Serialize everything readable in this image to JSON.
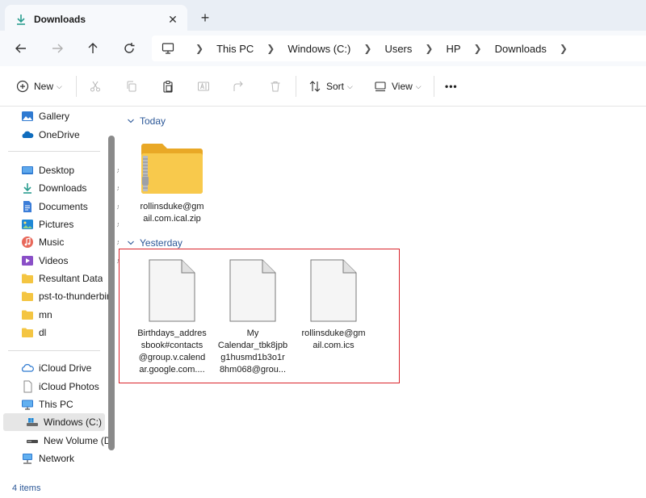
{
  "window": {
    "tab_title": "Downloads",
    "tab_close": "✕",
    "new_tab": "+"
  },
  "breadcrumb": [
    "This PC",
    "Windows (C:)",
    "Users",
    "HP",
    "Downloads"
  ],
  "toolbar": {
    "new_label": "New",
    "sort_label": "Sort",
    "view_label": "View",
    "more_label": "•••"
  },
  "sidebar": {
    "quick": [
      {
        "label": "Gallery",
        "icon": "gallery-icon"
      },
      {
        "label": "OneDrive",
        "icon": "onedrive-icon"
      }
    ],
    "pinned": [
      {
        "label": "Desktop",
        "icon": "desktop-icon",
        "pinned": true
      },
      {
        "label": "Downloads",
        "icon": "downloads-icon",
        "pinned": true
      },
      {
        "label": "Documents",
        "icon": "documents-icon",
        "pinned": true
      },
      {
        "label": "Pictures",
        "icon": "pictures-icon",
        "pinned": true
      },
      {
        "label": "Music",
        "icon": "music-icon",
        "pinned": true
      },
      {
        "label": "Videos",
        "icon": "videos-icon",
        "pinned": true
      },
      {
        "label": "Resultant Data",
        "icon": "folder-icon",
        "pinned": false
      },
      {
        "label": "pst-to-thunderbir",
        "icon": "folder-icon",
        "pinned": false
      },
      {
        "label": "mn",
        "icon": "folder-icon",
        "pinned": false
      },
      {
        "label": "dl",
        "icon": "folder-icon",
        "pinned": false
      }
    ],
    "locations": [
      {
        "label": "iCloud Drive",
        "icon": "icloud-drive-icon"
      },
      {
        "label": "iCloud Photos",
        "icon": "icloud-photos-icon"
      },
      {
        "label": "This PC",
        "icon": "this-pc-icon"
      },
      {
        "label": "Windows (C:)",
        "icon": "drive-c-icon",
        "selected": true
      },
      {
        "label": "New Volume (D:",
        "icon": "drive-d-icon"
      },
      {
        "label": "Network",
        "icon": "network-icon"
      }
    ]
  },
  "groups": {
    "today": "Today",
    "yesterday": "Yesterday"
  },
  "files": {
    "today": [
      {
        "name": "rollinsduke@gmail.com.ical.zip",
        "display": [
          "rollinsduke@gm",
          "ail.com.ical.zip"
        ],
        "icon": "zip-folder-icon"
      }
    ],
    "yesterday": [
      {
        "display": [
          "Birthdays_addres",
          "sbook#contacts",
          "@group.v.calend",
          "ar.google.com...."
        ],
        "icon": "file-icon"
      },
      {
        "display": [
          "My",
          "Calendar_tbk8jpb",
          "g1husmd1b3o1r",
          "8hm068@grou..."
        ],
        "icon": "file-icon"
      },
      {
        "display": [
          "rollinsduke@gm",
          "ail.com.ics"
        ],
        "icon": "file-icon"
      }
    ]
  },
  "status": {
    "item_count": "4 items"
  },
  "colors": {
    "accent": "#2b5797",
    "highlight_border": "#d9232a",
    "folder_yellow": "#f4c542"
  }
}
